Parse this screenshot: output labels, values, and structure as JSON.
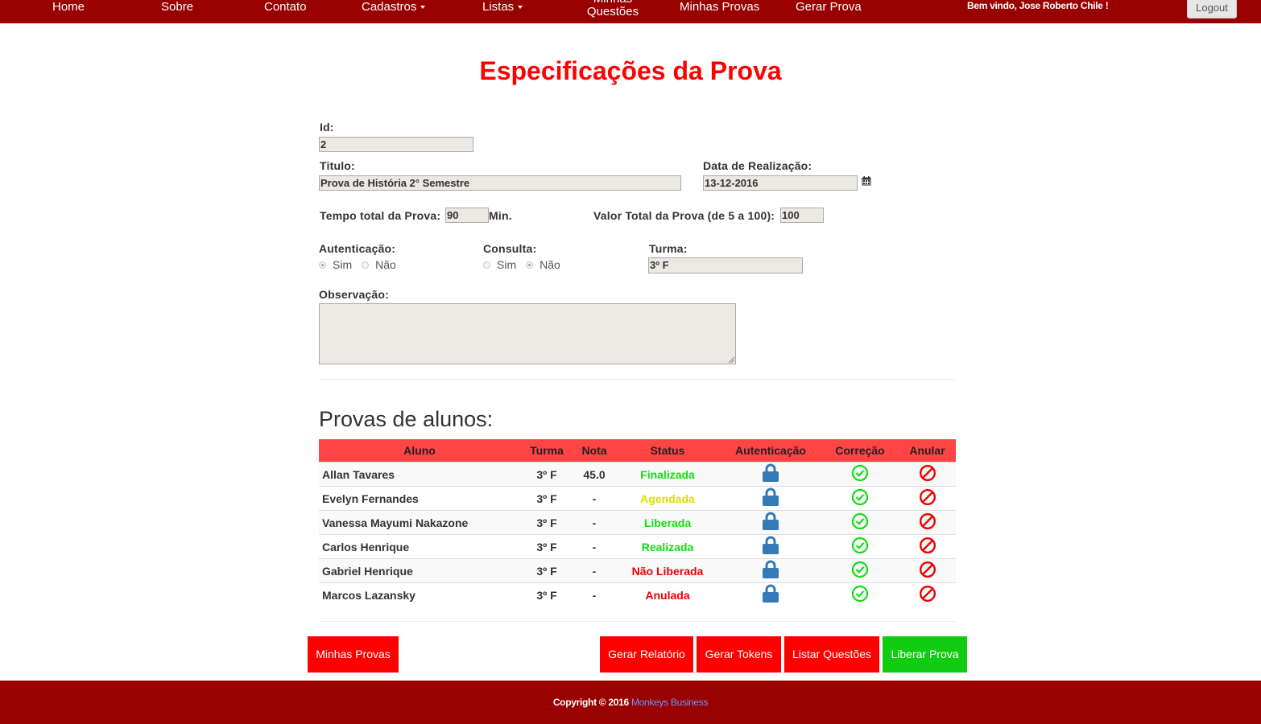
{
  "nav": {
    "items": [
      "Home",
      "Sobre",
      "Contato",
      "Cadastros",
      "Listas",
      "Minhas Questões",
      "Minhas Provas",
      "Gerar Prova"
    ],
    "welcome": "Bem vindo, Jose Roberto Chile !",
    "logout": "Logout"
  },
  "page": {
    "title": "Especificações da Prova"
  },
  "form": {
    "id_label": "Id:",
    "id_value": "2",
    "titulo_label": "Titulo:",
    "titulo_value": "Prova de História 2° Semestre",
    "data_label": "Data de Realização:",
    "data_value": "13-12-2016",
    "tempo_label": "Tempo total da Prova:",
    "tempo_value": "90",
    "tempo_unit": "Min.",
    "valor_label": "Valor Total da Prova (de 5 a 100):",
    "valor_value": "100",
    "autenticacao_label": "Autenticação:",
    "autenticacao_options": [
      "Sim",
      "Não"
    ],
    "autenticacao_selected": "Sim",
    "consulta_label": "Consulta:",
    "consulta_options": [
      "Sim",
      "Não"
    ],
    "consulta_selected": "Não",
    "turma_label": "Turma:",
    "turma_value": "3º F",
    "observacao_label": "Observação:",
    "observacao_value": ""
  },
  "table": {
    "title": "Provas de alunos:",
    "headers": [
      "Aluno",
      "Turma",
      "Nota",
      "Status",
      "Autenticação",
      "Correção",
      "Anular"
    ],
    "rows": [
      {
        "aluno": "Allan Tavares",
        "turma": "3º F",
        "nota": "45.0",
        "status": "Finalizada",
        "status_color": "#11dd11"
      },
      {
        "aluno": "Evelyn Fernandes",
        "turma": "3º F",
        "nota": "-",
        "status": "Agendada",
        "status_color": "#dddd00"
      },
      {
        "aluno": "Vanessa Mayumi Nakazone",
        "turma": "3º F",
        "nota": "-",
        "status": "Liberada",
        "status_color": "#11dd11"
      },
      {
        "aluno": "Carlos Henrique",
        "turma": "3º F",
        "nota": "-",
        "status": "Realizada",
        "status_color": "#11dd11"
      },
      {
        "aluno": "Gabriel Henrique",
        "turma": "3º F",
        "nota": "-",
        "status": "Não Liberada",
        "status_color": "#ee0000"
      },
      {
        "aluno": "Marcos Lazansky",
        "turma": "3º F",
        "nota": "-",
        "status": "Anulada",
        "status_color": "#ee0000"
      }
    ],
    "icons": {
      "autenticacao": "lock-icon",
      "correcao": "check-circle-icon",
      "anular": "ban-icon"
    }
  },
  "buttons": {
    "minhas_provas": "Minhas Provas",
    "gerar_relatorio": "Gerar Relatório",
    "gerar_tokens": "Gerar Tokens",
    "listar_questoes": "Listar Questões",
    "liberar_prova": "Liberar Prova"
  },
  "footer": {
    "copyright": "Copyright © 2016",
    "brand": "Monkeys Business"
  },
  "colors": {
    "navbar": "#990000",
    "title": "#ff0000",
    "table_header": "#ff4444",
    "button_red": "#ff0000",
    "button_green": "#11cc11",
    "lock": "#337ab7",
    "check": "#11dd11",
    "ban": "#ee0000",
    "footer_link": "#6699ff"
  }
}
